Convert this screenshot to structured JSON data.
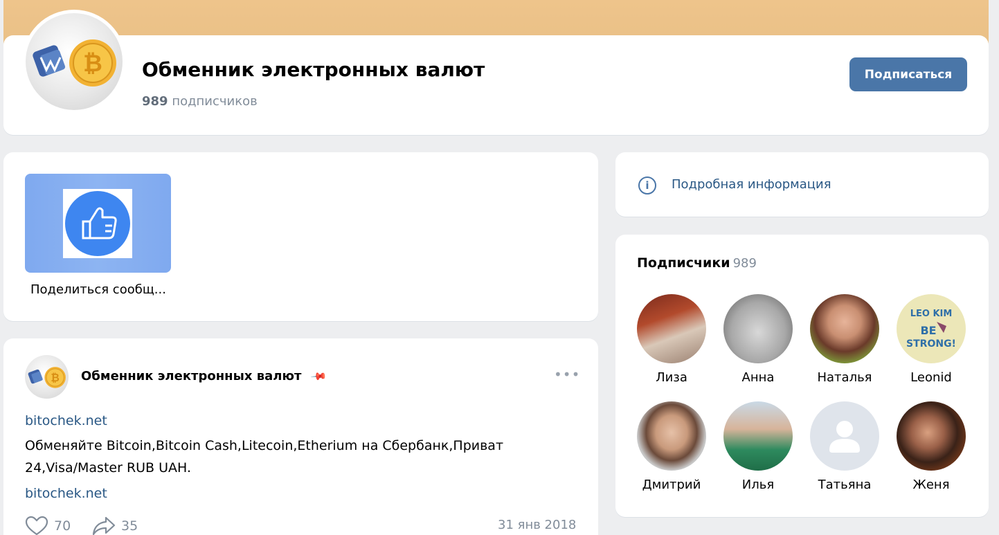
{
  "header": {
    "title": "Обменник электронных валют",
    "subscribers_count": "989",
    "subscribers_label": "подписчиков",
    "subscribe_button": "Подписаться"
  },
  "share": {
    "label": "Поделиться сообщ..."
  },
  "post": {
    "author": "Обменник электронных валют",
    "link1": "bitochek.net",
    "text": "Обменяйте Bitcoin,Bitcoin Cash,Litecoin,Etherium на Сбербанк,Приват 24,Visa/Master RUB UAH.",
    "link2": "bitochek.net",
    "likes": "70",
    "shares": "35",
    "date": "31 янв 2018"
  },
  "info": {
    "label": "Подробная информация"
  },
  "subscribers": {
    "title": "Подписчики",
    "count": "989",
    "items": [
      {
        "name": "Лиза"
      },
      {
        "name": "Анна"
      },
      {
        "name": "Наталья"
      },
      {
        "name": "Leonid"
      },
      {
        "name": "Дмитрий"
      },
      {
        "name": "Илья"
      },
      {
        "name": "Татьяна"
      },
      {
        "name": "Женя"
      }
    ]
  },
  "colors": {
    "accent": "#4a76a8",
    "link": "#2a5885",
    "cover": "#eec48b"
  }
}
